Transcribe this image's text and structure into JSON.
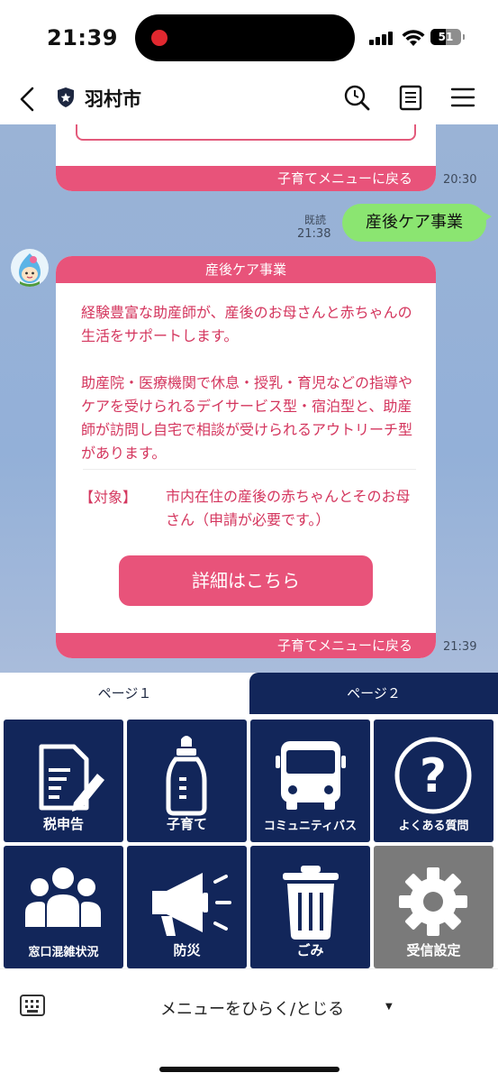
{
  "status_bar": {
    "time": "21:39",
    "battery": "51"
  },
  "header": {
    "title": "羽村市"
  },
  "chat": {
    "prev_card_footer": "子育てメニューに戻る",
    "prev_card_time": "20:30",
    "sent_read_label": "既読",
    "sent_time": "21:38",
    "sent_message": "産後ケア事業",
    "card": {
      "title": "産後ケア事業",
      "para1": "経験豊富な助産師が、産後のお母さんと赤ちゃんの生活をサポートします。",
      "para2": "助産院・医療機関で休息・授乳・育児などの指導やケアを受けられるデイサービス型・宿泊型と、助産師が訪問し自宅で相談が受けられるアウトリーチ型があります。",
      "target_label": "【対象】",
      "target_text": "市内在住の産後の赤ちゃんとそのお母さん（申請が必要です。）",
      "detail_button": "詳細はこちら",
      "footer": "子育てメニューに戻る",
      "time": "21:39"
    }
  },
  "menu": {
    "tabs": [
      "ページ１",
      "ページ２"
    ],
    "tiles": [
      {
        "label": "税申告",
        "icon": "tax-document-icon"
      },
      {
        "label": "子育て",
        "icon": "baby-bottle-icon"
      },
      {
        "label": "コミュニティバス",
        "icon": "bus-icon"
      },
      {
        "label": "よくある質問",
        "icon": "question-icon"
      },
      {
        "label": "窓口混雑状況",
        "icon": "crowd-icon"
      },
      {
        "label": "防災",
        "icon": "megaphone-icon"
      },
      {
        "label": "ごみ",
        "icon": "trash-icon"
      },
      {
        "label": "受信設定",
        "icon": "gear-icon"
      }
    ]
  },
  "bottom_bar": {
    "toggle_label": "メニューをひらく/とじる"
  },
  "colors": {
    "accent_pink": "#e8537a",
    "navy": "#12265a",
    "bubble_green": "#8be571"
  }
}
